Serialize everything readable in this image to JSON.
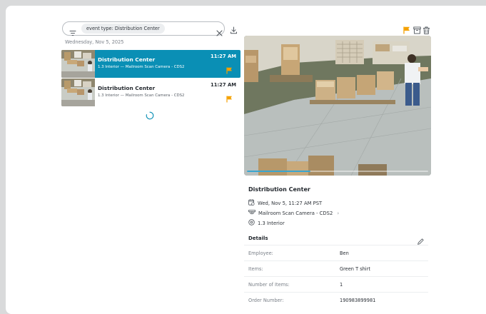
{
  "search": {
    "chip_label": "event type: Distribution Center",
    "filter_icon": "filter-icon",
    "clear_icon": "close-icon"
  },
  "toolbar": {
    "download_icon": "download-icon"
  },
  "list": {
    "date_header": "Wednesday, Nov 5, 2025",
    "events": [
      {
        "title": "Distribution Center",
        "subtitle": "1.3 Interior — Mailroom Scan Camera - CDS2",
        "time": "11:27 AM",
        "selected": true
      },
      {
        "title": "Distribution Center",
        "subtitle": "1.3 Interior — Mailroom Scan Camera - CDS2",
        "time": "11:27 AM",
        "selected": false
      }
    ],
    "loading": true
  },
  "colors": {
    "accent": "#0a8fb5",
    "flag": "#f5a100",
    "background": "#d9dadb"
  },
  "video": {
    "progress": 0.35
  },
  "detail": {
    "title": "Distribution Center",
    "datetime": "Wed, Nov 5, 11:27 AM PST",
    "camera": "Mailroom Scan Camera - CDS2",
    "location": "1.3 Interior",
    "details_label": "Details",
    "rows": [
      {
        "key": "Employee:",
        "value": "Ben"
      },
      {
        "key": "Items:",
        "value": "Green T shirt"
      },
      {
        "key": "Number of Items:",
        "value": "1"
      },
      {
        "key": "Order Number:",
        "value": "190983899981"
      }
    ]
  }
}
